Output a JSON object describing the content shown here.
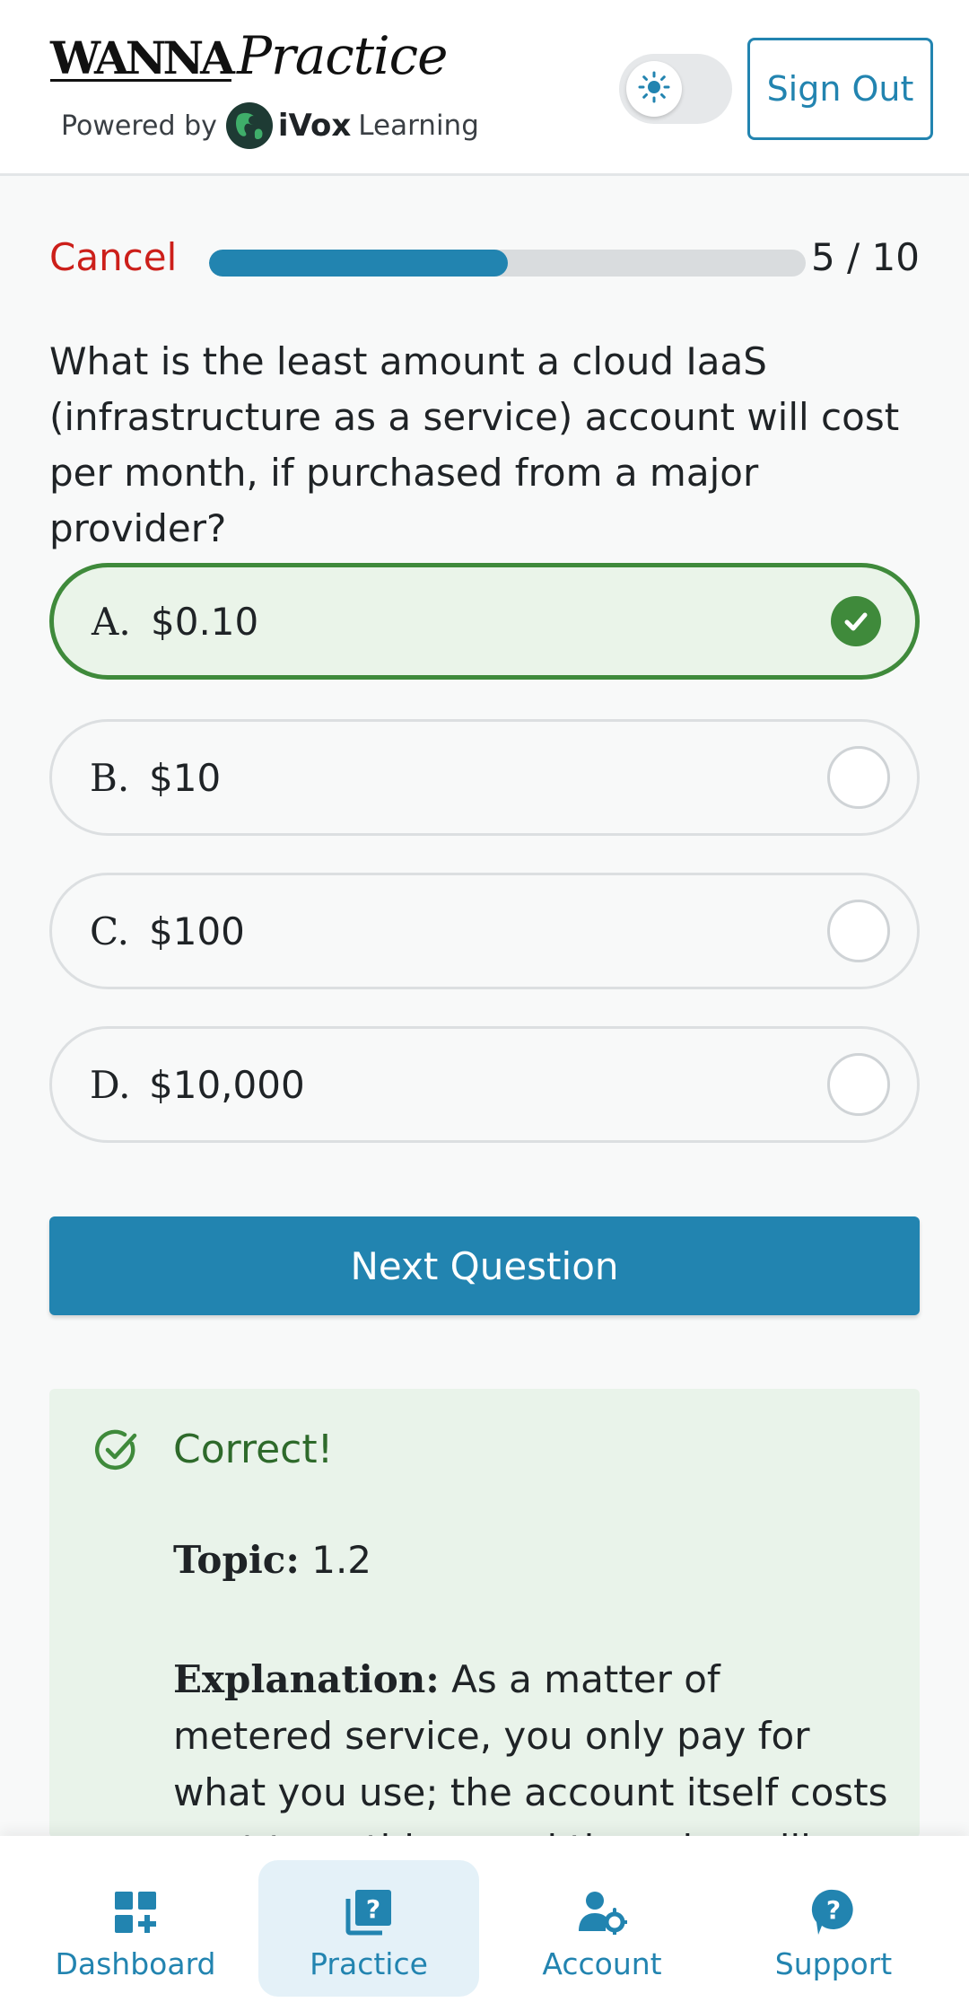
{
  "header": {
    "brand_wanna": "WANNA",
    "brand_practice": "Practice",
    "powered_by": "Powered by",
    "ivox_name": "iVox",
    "ivox_learning": "Learning",
    "sign_out_label": "Sign Out",
    "theme": "light"
  },
  "quiz": {
    "cancel_label": "Cancel",
    "progress": {
      "current": 5,
      "total": 10,
      "text": "5 / 10"
    },
    "question": "What is the least amount a cloud IaaS (infrastructure as a service) account will cost per month, if purchased from a major provider?",
    "options": [
      {
        "letter": "A.",
        "text": "$0.10",
        "state": "correct"
      },
      {
        "letter": "B.",
        "text": "$10",
        "state": "unselected"
      },
      {
        "letter": "C.",
        "text": "$100",
        "state": "unselected"
      },
      {
        "letter": "D.",
        "text": "$10,000",
        "state": "unselected"
      }
    ],
    "next_label": "Next Question"
  },
  "feedback": {
    "status": "Correct!",
    "topic_label": "Topic:",
    "topic_value": "1.2",
    "explanation_label": "Explanation:",
    "explanation_text": "As a matter of metered service, you only pay for what you use; the account itself costs next to nothing, and the price will only"
  },
  "nav": {
    "items": [
      {
        "label": "Dashboard",
        "icon": "dashboard-icon"
      },
      {
        "label": "Practice",
        "icon": "practice-icon",
        "active": true
      },
      {
        "label": "Account",
        "icon": "account-icon"
      },
      {
        "label": "Support",
        "icon": "support-icon"
      }
    ]
  },
  "colors": {
    "accent": "#2284b0",
    "cancel": "#cc1f1a",
    "correct": "#3f8a3b",
    "correct_bg": "#eaf4e9"
  }
}
